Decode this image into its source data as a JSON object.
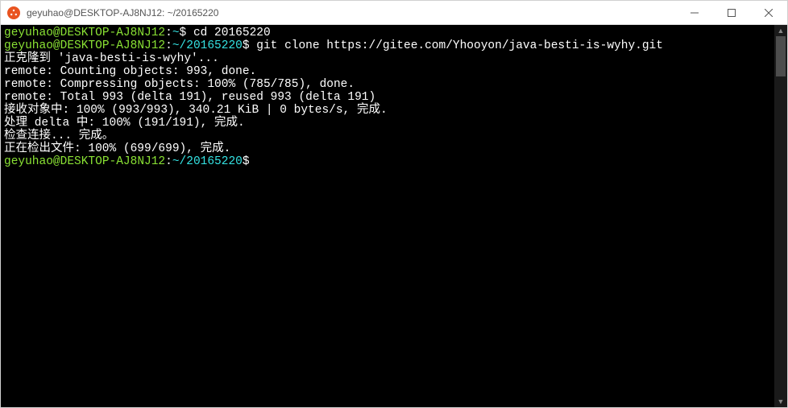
{
  "titlebar": {
    "title": "geyuhao@DESKTOP-AJ8NJ12: ~/20165220"
  },
  "prompt1": {
    "user": "geyuhao@DESKTOP-AJ8NJ12",
    "sep": ":",
    "path": "~",
    "dollar": "$ ",
    "cmd": "cd 20165220"
  },
  "prompt2": {
    "user": "geyuhao@DESKTOP-AJ8NJ12",
    "sep": ":",
    "path": "~/20165220",
    "dollar": "$ ",
    "cmd": "git clone https://gitee.com/Yhooyon/java-besti-is-wyhy.git"
  },
  "output": {
    "l1": "正克隆到 'java-besti-is-wyhy'...",
    "l2": "remote: Counting objects: 993, done.",
    "l3": "remote: Compressing objects: 100% (785/785), done.",
    "l4": "remote: Total 993 (delta 191), reused 993 (delta 191)",
    "l5": "接收对象中: 100% (993/993), 340.21 KiB | 0 bytes/s, 完成.",
    "l6": "处理 delta 中: 100% (191/191), 完成.",
    "l7": "检查连接... 完成。",
    "l8": "正在检出文件: 100% (699/699), 完成."
  },
  "prompt3": {
    "user": "geyuhao@DESKTOP-AJ8NJ12",
    "sep": ":",
    "path": "~/20165220",
    "dollar": "$"
  }
}
